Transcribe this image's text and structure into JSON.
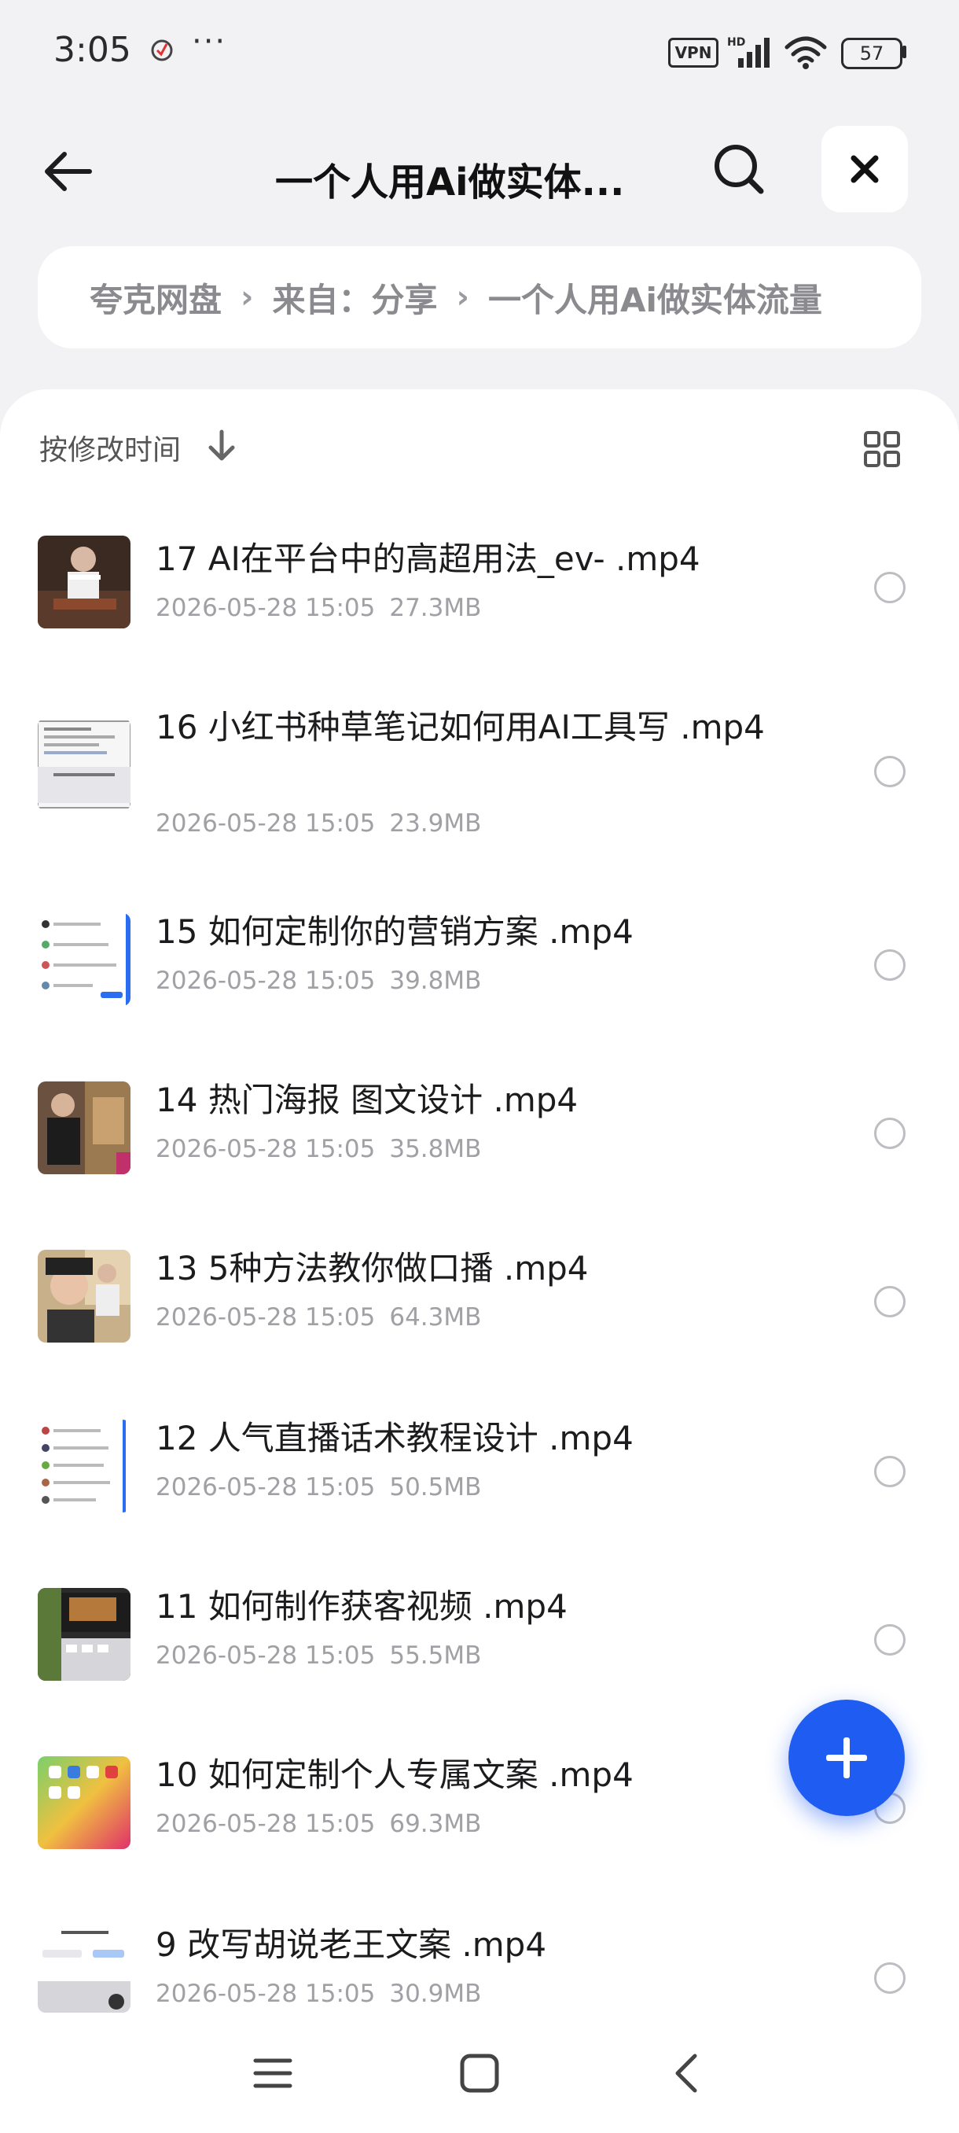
{
  "status": {
    "time": "3:05",
    "dots": "···",
    "vpn": "VPN",
    "battery": "57"
  },
  "header": {
    "title": "一个人用Ai做实体..."
  },
  "breadcrumb": {
    "items": [
      "夸克网盘",
      "来自：分享",
      "一个人用Ai做实体流量"
    ]
  },
  "sort": {
    "label": "按修改时间"
  },
  "files": [
    {
      "name": "17 AI在平台中的高超用法_ev- .mp4",
      "date": "2026-05-28 15:05",
      "size": "27.3MB"
    },
    {
      "name": "16 小红书种草笔记如何用AI工具写 .mp4",
      "date": "2026-05-28 15:05",
      "size": "23.9MB"
    },
    {
      "name": "15 如何定制你的营销方案 .mp4",
      "date": "2026-05-28 15:05",
      "size": "39.8MB"
    },
    {
      "name": "14 热门海报 图文设计 .mp4",
      "date": "2026-05-28 15:05",
      "size": "35.8MB"
    },
    {
      "name": "13 5种方法教你做口播 .mp4",
      "date": "2026-05-28 15:05",
      "size": "64.3MB"
    },
    {
      "name": "12 人气直播话术教程设计 .mp4",
      "date": "2026-05-28 15:05",
      "size": "50.5MB"
    },
    {
      "name": "11 如何制作获客视频 .mp4",
      "date": "2026-05-28 15:05",
      "size": "55.5MB"
    },
    {
      "name": "10 如何定制个人专属文案 .mp4",
      "date": "2026-05-28 15:05",
      "size": "69.3MB"
    },
    {
      "name": "9 改写胡说老王文案 .mp4",
      "date": "2026-05-28 15:05",
      "size": "30.9MB"
    }
  ],
  "colors": {
    "accent": "#1f5cf2",
    "background": "#f2f2f4",
    "meta_text": "#a0a0a5"
  },
  "icons": {
    "header": [
      "back-arrow-icon",
      "search-icon",
      "close-icon"
    ],
    "list": [
      "sort-down-arrow-icon",
      "grid-view-icon",
      "select-radio-icon"
    ],
    "fab": "plus-icon",
    "navbar": [
      "menu-icon",
      "home-square-icon",
      "back-chevron-icon"
    ]
  }
}
